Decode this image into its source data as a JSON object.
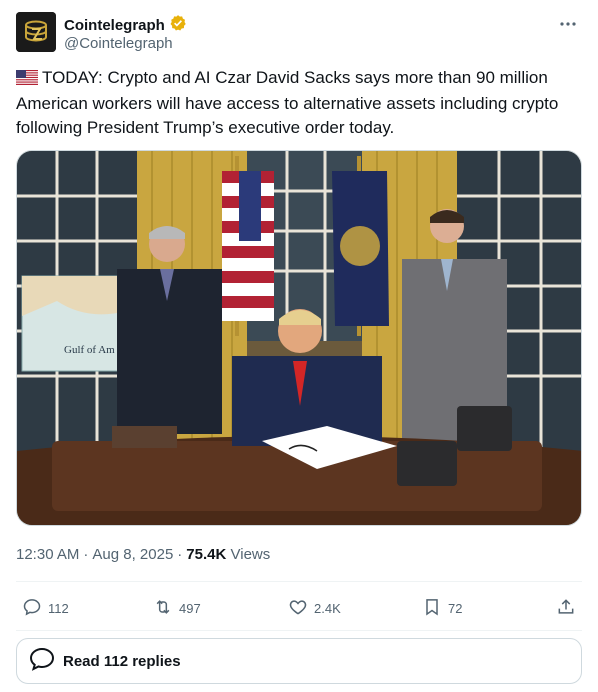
{
  "author": {
    "display_name": "Cointelegraph",
    "handle": "@Cointelegraph",
    "verified": true,
    "badge_color": "#e8b10a"
  },
  "tweet": {
    "flag_icon": "us-flag-icon",
    "text": "TODAY: Crypto and AI Czar David Sacks says more than 90 million American workers will have access to alternative assets including crypto following President Trump’s executive order today."
  },
  "media": {
    "map_label": "Gulf of Am"
  },
  "meta": {
    "time": "12:30 AM",
    "date": "Aug 8, 2025",
    "views_count": "75.4K",
    "views_label": "Views"
  },
  "actions": {
    "replies": "112",
    "reposts": "497",
    "likes": "2.4K",
    "bookmarks": "72"
  },
  "read_replies": "Read 112 replies",
  "colors": {
    "text": "#0f1419",
    "secondary": "#536471",
    "border": "#cfd9de"
  }
}
